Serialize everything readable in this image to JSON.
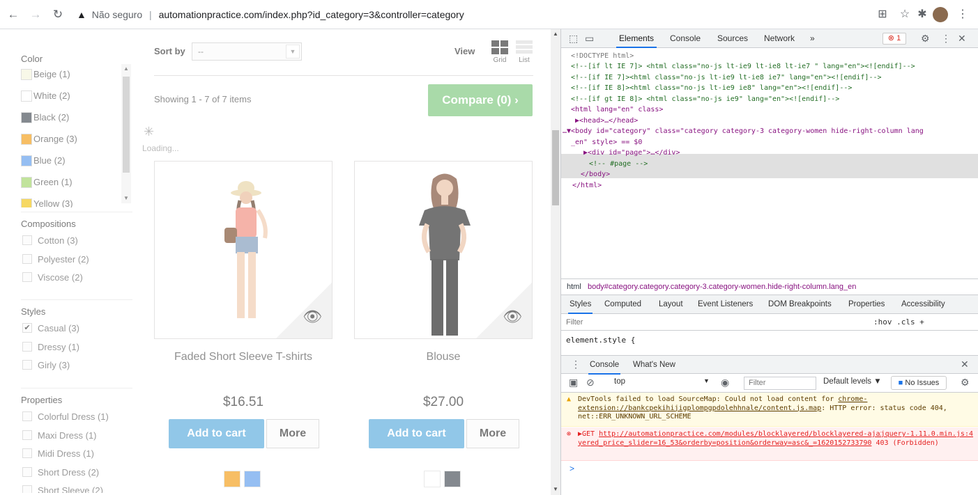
{
  "browser": {
    "security_label": "Não seguro",
    "url": "automationpractice.com/index.php?id_category=3&controller=category"
  },
  "filters": {
    "color_title": "Color",
    "colors": [
      {
        "label": "Beige (1)",
        "swatch": "#f5f5dc"
      },
      {
        "label": "White (2)",
        "swatch": "#ffffff"
      },
      {
        "label": "Black (2)",
        "swatch": "#434a54"
      },
      {
        "label": "Orange (3)",
        "swatch": "#f39c11"
      },
      {
        "label": "Blue (2)",
        "swatch": "#5d9cec"
      },
      {
        "label": "Green (1)",
        "swatch": "#a0d468"
      },
      {
        "label": "Yellow (3)",
        "swatch": "#f1c40f"
      }
    ],
    "compositions_title": "Compositions",
    "compositions": [
      "Cotton (3)",
      "Polyester (2)",
      "Viscose (2)"
    ],
    "styles_title": "Styles",
    "styles": [
      {
        "label": "Casual (3)",
        "checked": true
      },
      {
        "label": "Dressy (1)",
        "checked": false
      },
      {
        "label": "Girly (3)",
        "checked": false
      }
    ],
    "properties_title": "Properties",
    "properties": [
      "Colorful Dress (1)",
      "Maxi Dress (1)",
      "Midi Dress (1)",
      "Short Dress (2)",
      "Short Sleeve (2)"
    ]
  },
  "toolbar": {
    "sort_label": "Sort by",
    "sort_value": "--",
    "view_label": "View",
    "grid_label": "Grid",
    "list_label": "List",
    "showing": "Showing 1 - 7 of 7 items",
    "compare_label": "Compare (0)",
    "loading": "Loading..."
  },
  "products": [
    {
      "name": "Faded Short Sleeve T-shirts",
      "price": "$16.51",
      "add_label": "Add to cart",
      "more_label": "More",
      "swatches": [
        "#f39c11",
        "#5d9cec"
      ]
    },
    {
      "name": "Blouse",
      "price": "$27.00",
      "add_label": "Add to cart",
      "more_label": "More",
      "swatches": [
        "#ffffff",
        "#434a54"
      ]
    }
  ],
  "devtools": {
    "tabs": [
      "Elements",
      "Console",
      "Sources",
      "Network"
    ],
    "more": "»",
    "error_count": "1",
    "dom_lines": [
      "<!DOCTYPE html>",
      "<!--[if lt IE 7]> <html class=\"no-js lt-ie9 lt-ie8 lt-ie7 \" lang=\"en\"><![endif]-->",
      "<!--[if IE 7]><html class=\"no-js lt-ie9 lt-ie8 ie7\" lang=\"en\"><![endif]-->",
      "<!--[if IE 8]><html class=\"no-js lt-ie9 ie8\" lang=\"en\"><![endif]-->",
      "<!--[if gt IE 8]> <html class=\"no-js ie9\" lang=\"en\"><![endif]-->",
      "<html lang=\"en\" class>",
      "▶<head>…</head>",
      "…▼<body id=\"category\" class=\"category category-3 category-women hide-right-column lang",
      "_en\" style> == $0",
      "▶<div id=\"page\">…</div>",
      "<!-- #page -->",
      "</body>",
      "</html>"
    ],
    "breadcrumb_html": "html",
    "breadcrumb_body": "body#category.category.category-3.category-women.hide-right-column.lang_en",
    "subtabs": [
      "Styles",
      "Computed",
      "Layout",
      "Event Listeners",
      "DOM Breakpoints",
      "Properties",
      "Accessibility"
    ],
    "filter_placeholder": "Filter",
    "hov_cls": ":hov .cls +",
    "element_style": "element.style {",
    "drawer_tabs": [
      "Console",
      "What's New"
    ],
    "context": "top",
    "console_filter": "Filter",
    "default_levels": "Default levels ▼",
    "no_issues": "No Issues",
    "warning_text": "DevTools failed to load SourceMap: Could not load content for ",
    "warning_link": "chrome-extension://bankcpekihijigplompgpdolehhnale/content.js.map",
    "warning_tail": ": HTTP error: status code 404, net::ERR_UNKNOWN_URL_SCHEME",
    "error_prefix": "▶GET ",
    "error_link": "http://automationpractice.com/modules/blocklayered/blocklayered-ajax.php?la…yered_price_slider=16_53&orderby=position&orderway=asc&_=1620152733790",
    "error_status": "403 (Forbidden)",
    "error_source": "jquery-1.11.0.min.js:4",
    "prompt": ">"
  }
}
